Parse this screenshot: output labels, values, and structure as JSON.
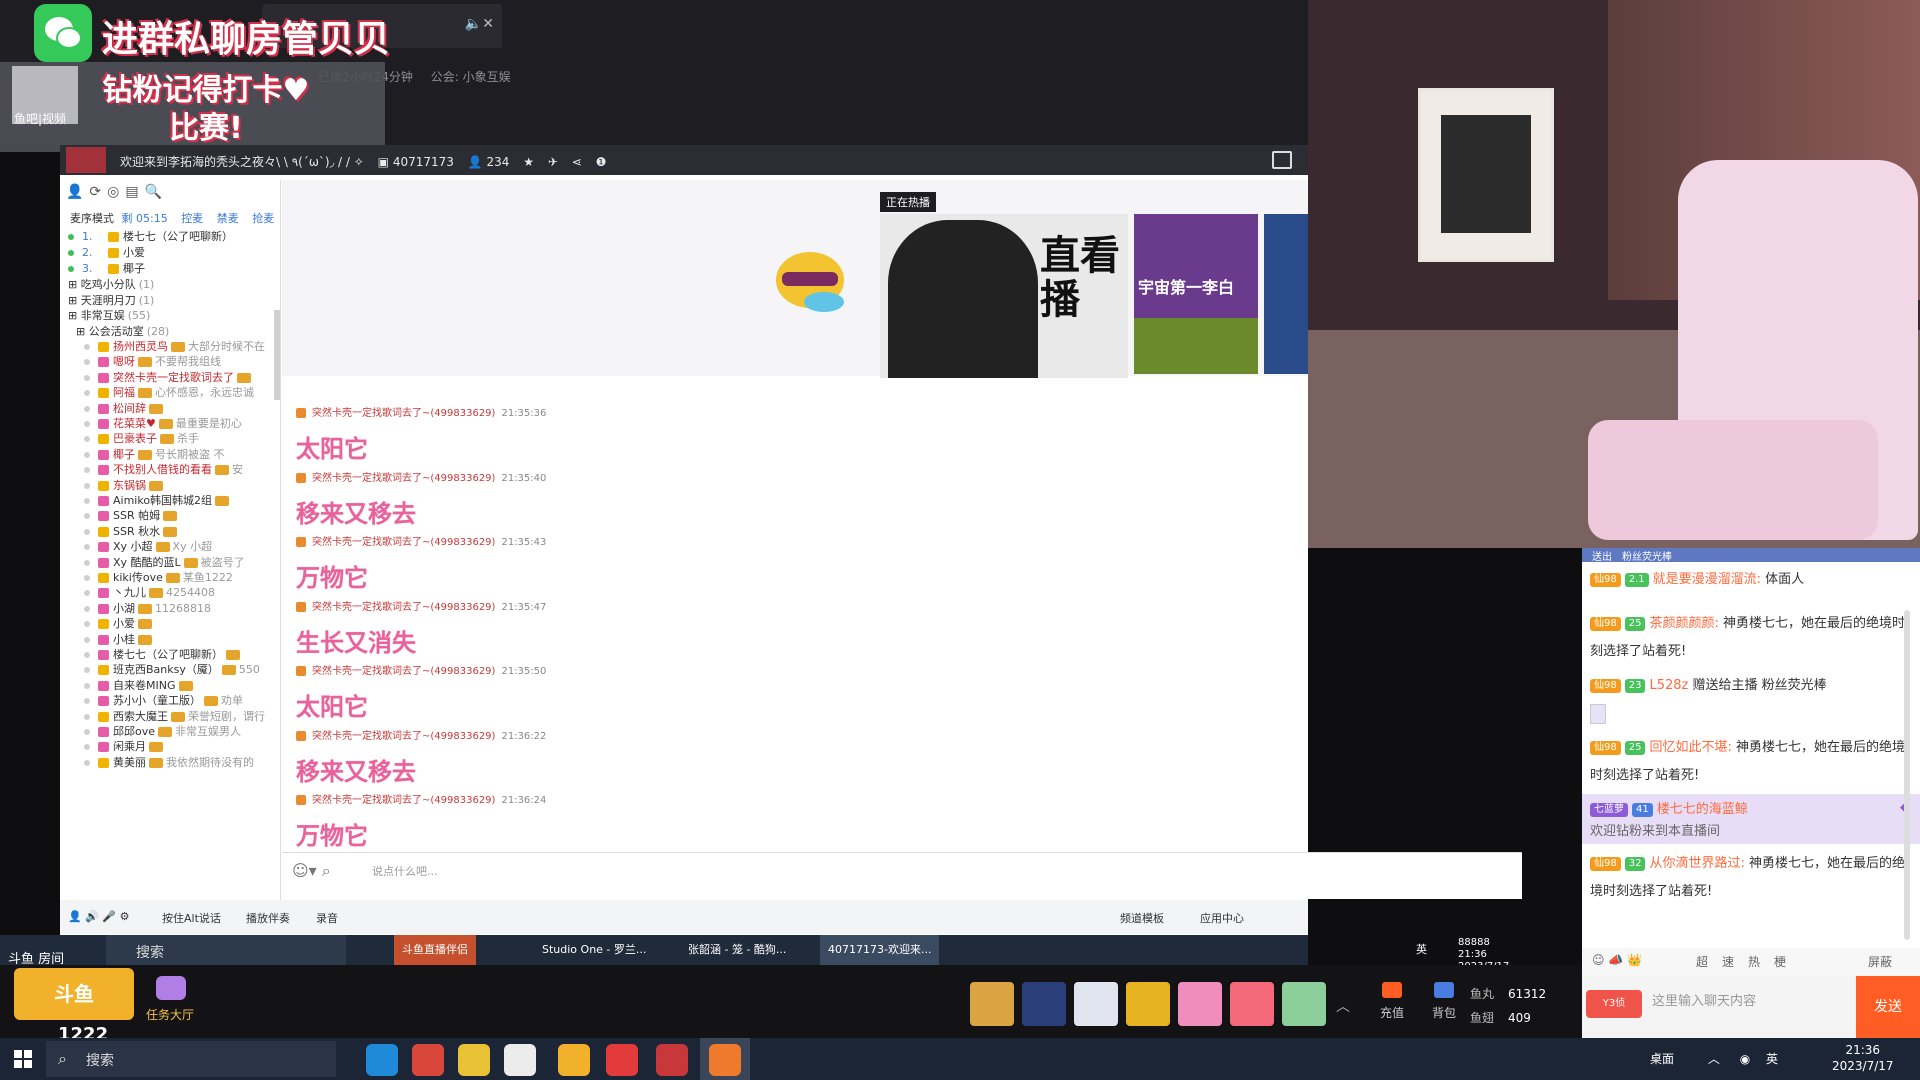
{
  "overlay": {
    "wechat_text": "进群私聊房管贝贝",
    "fan_text_line1": "钻粉记得打卡♥",
    "fan_text_line2": "比赛!",
    "avatar_caption": "鱼吧|视频",
    "room_meta": [
      "已播2小时24分钟",
      "公会: 小象互娱"
    ]
  },
  "inner_app": {
    "title": "欢迎来到李拓海的秃头之夜々\\ \\ ٩(´ω`)◞ / / ✧",
    "room_id": "40717173",
    "viewers": "234",
    "hot_label": "正在热播",
    "hot_card1_title": "直看播",
    "hot_card2_title": "宇宙第一李白",
    "input_placeholder": "说点什么吧..."
  },
  "left_panel": {
    "mode": "麦序模式",
    "time": "剩 05:15",
    "actions": [
      "控麦",
      "禁麦",
      "抢麦"
    ],
    "queue": [
      {
        "num": "1.",
        "name": "楼七七（公了吧聊新）"
      },
      {
        "num": "2.",
        "name": "小爱"
      },
      {
        "num": "3.",
        "name": "椰子"
      }
    ],
    "groups": [
      {
        "name": "吃鸡小分队",
        "count": "(1)"
      },
      {
        "name": "天涯明月刀",
        "count": "(1)"
      },
      {
        "name": "非常互娱",
        "count": "(55)"
      },
      {
        "name": "公会活动室",
        "count": "(28)"
      }
    ],
    "members": [
      {
        "name": "扬州西灵鸟",
        "note": "大部分时候不在"
      },
      {
        "name": "嗯呀",
        "note": "不要帮我组线"
      },
      {
        "name": "突然卡壳一定找歌词去了",
        "note": ""
      },
      {
        "name": "阿福",
        "note": "心怀感恩，永远忠诚"
      },
      {
        "name": "松间辞",
        "note": ""
      },
      {
        "name": "花菜菜♥",
        "note": "最重要是初心"
      },
      {
        "name": "巴豪表子",
        "note": "杀手"
      },
      {
        "name": "椰子",
        "note": "号长期被盗 不"
      },
      {
        "name": "不找别人借钱的看看",
        "note": "安"
      },
      {
        "name": "东锅锅",
        "note": ""
      },
      {
        "name": "Aimiko韩国韩城2组",
        "note": ""
      },
      {
        "name": "SSR 帕姆",
        "note": ""
      },
      {
        "name": "SSR 秋水",
        "note": ""
      },
      {
        "name": "Xy 小超",
        "note": "Xy 小超"
      },
      {
        "name": "Xy 酷酷的蓝L",
        "note": "被盗号了"
      },
      {
        "name": "kiki传ove",
        "note": "某鱼1222"
      },
      {
        "name": "丶九儿",
        "note": "4254408"
      },
      {
        "name": "小湖",
        "note": "11268818"
      },
      {
        "name": "小爱",
        "note": ""
      },
      {
        "name": "小桂",
        "note": ""
      },
      {
        "name": "楼七七（公了吧聊新）",
        "note": ""
      },
      {
        "name": "班克西Banksy（魇）",
        "note": "550"
      },
      {
        "name": "自来卷MING",
        "note": ""
      },
      {
        "name": "苏小小（童工版）",
        "note": "劝单"
      },
      {
        "name": "西索大魔王",
        "note": "荣誉短剧，谓行"
      },
      {
        "name": "邱邱ove",
        "note": "非常互娱男人"
      },
      {
        "name": "闲乘月",
        "note": ""
      },
      {
        "name": "黄美丽",
        "note": "我依然期待没有的"
      }
    ]
  },
  "lyrics": [
    {
      "user": "突然卡壳一定找歌词去了~(499833629)",
      "time": "21:35:36",
      "text": "太阳它"
    },
    {
      "user": "突然卡壳一定找歌词去了~(499833629)",
      "time": "21:35:40",
      "text": "移来又移去"
    },
    {
      "user": "突然卡壳一定找歌词去了~(499833629)",
      "time": "21:35:43",
      "text": "万物它"
    },
    {
      "user": "突然卡壳一定找歌词去了~(499833629)",
      "time": "21:35:47",
      "text": "生长又消失"
    },
    {
      "user": "突然卡壳一定找歌词去了~(499833629)",
      "time": "21:35:50",
      "text": "太阳它"
    },
    {
      "user": "突然卡壳一定找歌词去了~(499833629)",
      "time": "21:36:22",
      "text": "移来又移去"
    },
    {
      "user": "突然卡壳一定找歌词去了~(499833629)",
      "time": "21:36:24",
      "text": "万物它"
    }
  ],
  "bottom_toolbar": [
    "按住Alt说话",
    "播放伴奏",
    "录音",
    "频道模板",
    "应用中心"
  ],
  "inner_taskbar": {
    "search": "搜索",
    "tasks": [
      "斗鱼直播伴侣",
      "Studio One - 罗兰...",
      "张韶涵 - 笼 - 酷狗...",
      "40717173-欢迎来..."
    ],
    "lang": "英",
    "time": "21:36",
    "date": "2023/7/17",
    "pre": "88888"
  },
  "right_chat": {
    "header": "送出　粉丝荧光棒",
    "messages": [
      {
        "lvl": "仙98",
        "fan": "2.1",
        "name": "就是要漫漫溜溜流:",
        "text": "体面人"
      },
      {
        "lvl": "仙98",
        "fan": "25",
        "name": "茶颜颜颜颜:",
        "text": "神勇楼七七，她在最后的绝境时刻选择了站着死!"
      },
      {
        "lvl": "仙98",
        "fan": "23",
        "name": "L528z",
        "text": "赠送给主播 粉丝荧光棒"
      },
      {
        "lvl": "仙98",
        "fan": "25",
        "name": "回忆如此不堪:",
        "text": "神勇楼七七，她在最后的绝境时刻选择了站着死!"
      },
      {
        "lvl": "仙98",
        "fan": "32",
        "name": "从你滴世界路过:",
        "text": "神勇楼七七，她在最后的绝境时刻选择了站着死!"
      }
    ],
    "vip": {
      "badge": "七蓝萝",
      "fan": "41",
      "name": "楼七七的海蓝鲸",
      "welcome": "欢迎钻粉来到本直播间"
    },
    "tools": [
      "超",
      "速",
      "热",
      "梗",
      "屏蔽"
    ],
    "input_placeholder": "这里输入聊天内容",
    "send": "发送",
    "level_tag": "Y3侦"
  },
  "douyu_bar": {
    "tag": "斗鱼 房间",
    "count": "1222",
    "task_hall": "任务大厅",
    "recharge": "充值",
    "backpack": "背包",
    "fish_balls_label": "鱼丸",
    "fish_balls": "61312",
    "fish_fins_label": "鱼翅",
    "fish_fins": "409"
  },
  "windows": {
    "search": "搜索",
    "tray_desktop": "桌面",
    "lang": "英",
    "time": "21:36",
    "date": "2023/7/17"
  },
  "colors": {
    "accent_orange": "#ff5d23",
    "lyric_pink": "#e8639b",
    "wechat_green": "#35c95a"
  }
}
